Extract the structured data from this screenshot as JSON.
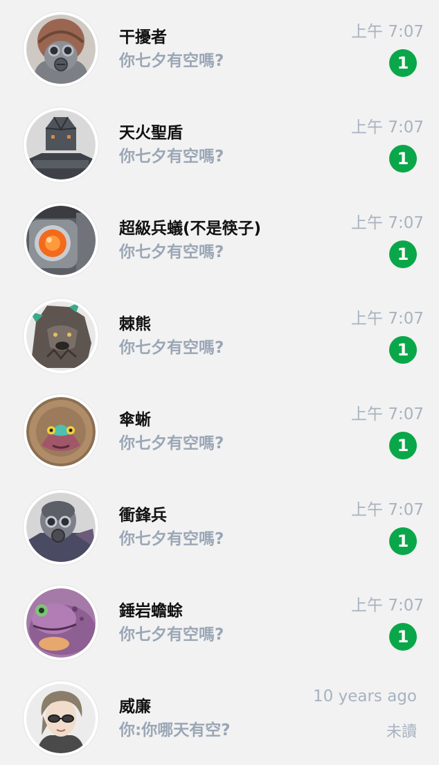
{
  "colors": {
    "background": "#f2f2f2",
    "badge": "#0aa74a",
    "name": "#111111",
    "preview": "#9aa6b6",
    "time": "#a8b2c0"
  },
  "chats": [
    {
      "name": "干擾者",
      "preview": "你七夕有空嗎?",
      "time": "上午 7:07",
      "unread": "1",
      "avatar_icon": "gas-mask-helmet-avatar-icon"
    },
    {
      "name": "天火聖盾",
      "preview": "你七夕有空嗎?",
      "time": "上午 7:07",
      "unread": "1",
      "avatar_icon": "armored-helmet-avatar-icon"
    },
    {
      "name": "超級兵蟻(不是筷子)",
      "preview": "你七夕有空嗎?",
      "time": "上午 7:07",
      "unread": "1",
      "avatar_icon": "robot-red-eye-avatar-icon"
    },
    {
      "name": "棘熊",
      "preview": "你七夕有空嗎?",
      "time": "上午 7:07",
      "unread": "1",
      "avatar_icon": "spiky-bear-avatar-icon"
    },
    {
      "name": "傘蜥",
      "preview": "你七夕有空嗎?",
      "time": "上午 7:07",
      "unread": "1",
      "avatar_icon": "frilled-lizard-avatar-icon"
    },
    {
      "name": "衝鋒兵",
      "preview": "你七夕有空嗎?",
      "time": "上午 7:07",
      "unread": "1",
      "avatar_icon": "gas-mask-trooper-avatar-icon"
    },
    {
      "name": "錘岩蟾蜍",
      "preview": "你七夕有空嗎?",
      "time": "上午 7:07",
      "unread": "1",
      "avatar_icon": "purple-toad-avatar-icon"
    },
    {
      "name": "威廉",
      "preview": "你:你哪天有空?",
      "time": "10 years ago",
      "status": "未讀",
      "avatar_icon": "man-with-glasses-avatar-icon"
    }
  ]
}
